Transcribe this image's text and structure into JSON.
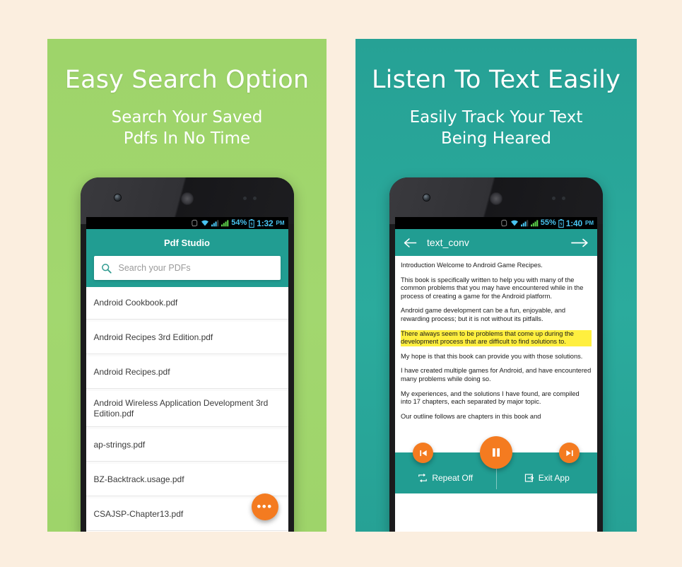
{
  "theme": {
    "page_background": "#fbeedf",
    "panel_left_color": "#9ed46a",
    "panel_right_color": "#26a195",
    "appbar_color": "#219d92",
    "accent_orange": "#f47b20",
    "highlight_yellow": "#ffef3f",
    "status_text_color": "#49c3f0"
  },
  "panels": [
    {
      "headline": "Easy Search Option",
      "sub_line1": "Search Your Saved",
      "sub_line2": "Pdfs In No Time"
    },
    {
      "headline": "Listen To Text Easily",
      "sub_line1": "Easily Track Your Text",
      "sub_line2": "Being Heared"
    }
  ],
  "phone_left": {
    "status_bar": {
      "battery_percent": "54%",
      "time": "1:32",
      "ampm": "PM",
      "icons": [
        "rotation-lock-icon",
        "wifi-icon",
        "signal-icon",
        "signal-icon",
        "battery-icon"
      ]
    },
    "app": {
      "title": "Pdf Studio",
      "search_placeholder": "Search your PDFs",
      "search_value": "",
      "search_icon": "search-icon",
      "fab_label": "•••",
      "files": [
        "Android Cookbook.pdf",
        "Android Recipes 3rd Edition.pdf",
        "Android Recipes.pdf",
        "Android Wireless Application Development 3rd Edition.pdf",
        "ap-strings.pdf",
        "BZ-Backtrack.usage.pdf",
        "CSAJSP-Chapter13.pdf"
      ]
    }
  },
  "phone_right": {
    "status_bar": {
      "battery_percent": "55%",
      "time": "1:40",
      "ampm": "PM",
      "icons": [
        "rotation-lock-icon",
        "wifi-icon",
        "signal-icon",
        "signal-icon",
        "battery-icon"
      ]
    },
    "app": {
      "title": "text_conv",
      "back_icon": "arrow-left-icon",
      "forward_icon": "arrow-right-icon",
      "paragraphs": [
        {
          "text": "Introduction\nWelcome to Android Game Recipes.",
          "highlighted": false
        },
        {
          "text": "This book is specifically written to help you with many of the\ncommon problems that you may have encountered while in the process of creating a game for the Android platform.",
          "highlighted": false
        },
        {
          "text": "Android game development can be a fun, enjoyable, and rewarding process; but\nit is not without its pitfalls.",
          "highlighted": false
        },
        {
          "text": "There always seem to be problems that come up during the development\nprocess that are difficult to find solutions to.",
          "highlighted": true
        },
        {
          "text": "My hope is that this book can provide you with those solutions.",
          "highlighted": false
        },
        {
          "text": "I have created multiple games for Android, and have encountered many problems while doing so.",
          "highlighted": false
        },
        {
          "text": "My\nexperiences, and the solutions I have found, are compiled into 17 chapters, each separated by major topic.",
          "highlighted": false
        },
        {
          "text": "Our outline follows are chapters in this book and",
          "highlighted": false
        }
      ],
      "player": {
        "previous_label": "previous-track",
        "play_pause_label": "pause",
        "next_label": "next-track",
        "repeat_label": "Repeat Off",
        "exit_label": "Exit App"
      }
    }
  }
}
